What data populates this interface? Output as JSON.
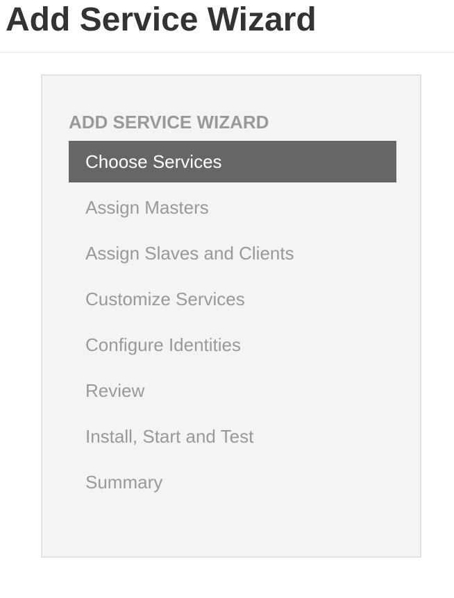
{
  "page": {
    "title": "Add Service Wizard"
  },
  "wizard": {
    "heading": "ADD SERVICE WIZARD",
    "active_step_index": 0,
    "steps": [
      {
        "label": "Choose Services",
        "active": true
      },
      {
        "label": "Assign Masters",
        "active": false
      },
      {
        "label": "Assign Slaves and Clients",
        "active": false
      },
      {
        "label": "Customize Services",
        "active": false
      },
      {
        "label": "Configure Identities",
        "active": false
      },
      {
        "label": "Review",
        "active": false
      },
      {
        "label": "Install, Start and Test",
        "active": false
      },
      {
        "label": "Summary",
        "active": false
      }
    ]
  },
  "colors": {
    "title_text": "#333333",
    "muted_text": "#999999",
    "active_step_bg": "#666666",
    "active_step_text": "#ffffff",
    "panel_bg": "#f4f4f4",
    "panel_border": "#e3e3e3"
  }
}
